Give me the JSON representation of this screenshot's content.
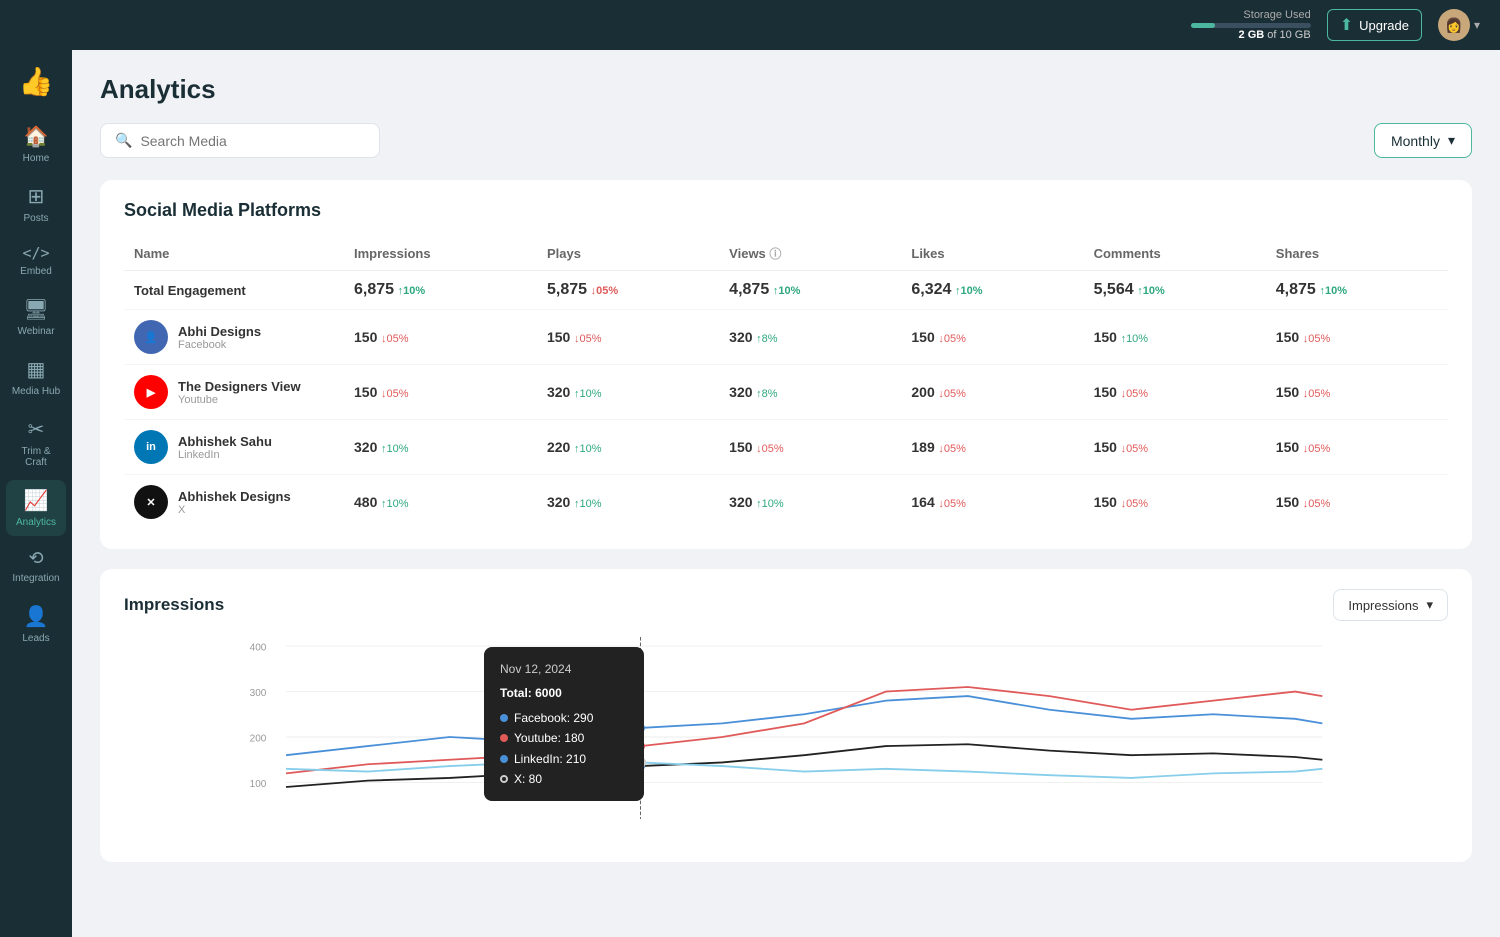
{
  "topbar": {
    "storage_label": "Storage Used",
    "storage_used": "2 GB",
    "storage_total": "10 GB",
    "storage_text": "2 GB of 10 GB",
    "upgrade_label": "Upgrade"
  },
  "sidebar": {
    "items": [
      {
        "id": "home",
        "label": "Home",
        "icon": "🏠"
      },
      {
        "id": "posts",
        "label": "Posts",
        "icon": "▦"
      },
      {
        "id": "embed",
        "label": "Embed",
        "icon": "</>"
      },
      {
        "id": "webinar",
        "label": "Webinar",
        "icon": "🖥"
      },
      {
        "id": "media-hub",
        "label": "Media Hub",
        "icon": "⊞"
      },
      {
        "id": "trim-craft",
        "label": "Trim & Craft",
        "icon": "✂"
      },
      {
        "id": "analytics",
        "label": "Analytics",
        "icon": "📈",
        "active": true
      },
      {
        "id": "integration",
        "label": "Integration",
        "icon": "⟲"
      },
      {
        "id": "leads",
        "label": "Leads",
        "icon": "👤"
      }
    ]
  },
  "page": {
    "title": "Analytics"
  },
  "search": {
    "placeholder": "Search Media"
  },
  "filter": {
    "label": "Monthly"
  },
  "social_section": {
    "title": "Social Media Platforms",
    "columns": [
      "Name",
      "Impressions",
      "Plays",
      "Views",
      "Likes",
      "Comments",
      "Shares"
    ],
    "total_row": {
      "name": "Total Engagement",
      "impressions": "6,875",
      "impressions_change": "↑10%",
      "impressions_up": true,
      "plays": "5,875",
      "plays_change": "↓05%",
      "plays_up": false,
      "views": "4,875",
      "views_change": "↑10%",
      "views_up": true,
      "likes": "6,324",
      "likes_change": "↑10%",
      "likes_up": true,
      "comments": "5,564",
      "comments_change": "↑10%",
      "comments_up": true,
      "shares": "4,875",
      "shares_change": "↑10%",
      "shares_up": true
    },
    "rows": [
      {
        "name": "Abhi Designs",
        "platform": "Facebook",
        "avatar_color": "#4267B2",
        "avatar_emoji": "👤",
        "impressions": "150",
        "impressions_change": "↓05%",
        "impressions_up": false,
        "plays": "150",
        "plays_change": "↓05%",
        "plays_up": false,
        "views": "320",
        "views_change": "↑8%",
        "views_up": true,
        "likes": "150",
        "likes_change": "↓05%",
        "likes_up": false,
        "comments": "150",
        "comments_change": "↑10%",
        "comments_up": true,
        "shares": "150",
        "shares_change": "↓05%",
        "shares_up": false
      },
      {
        "name": "The Designers View",
        "platform": "Youtube",
        "avatar_color": "#FF0000",
        "avatar_emoji": "🎥",
        "impressions": "150",
        "impressions_change": "↓05%",
        "impressions_up": false,
        "plays": "320",
        "plays_change": "↑10%",
        "plays_up": true,
        "views": "320",
        "views_change": "↑8%",
        "views_up": true,
        "likes": "200",
        "likes_change": "↓05%",
        "likes_up": false,
        "comments": "150",
        "comments_change": "↓05%",
        "comments_up": false,
        "shares": "150",
        "shares_change": "↓05%",
        "shares_up": false
      },
      {
        "name": "Abhishek Sahu",
        "platform": "LinkedIn",
        "avatar_color": "#0077B5",
        "avatar_emoji": "💼",
        "impressions": "320",
        "impressions_change": "↑10%",
        "impressions_up": true,
        "plays": "220",
        "plays_change": "↑10%",
        "plays_up": true,
        "views": "150",
        "views_change": "↓05%",
        "views_up": false,
        "likes": "189",
        "likes_change": "↓05%",
        "likes_up": false,
        "comments": "150",
        "comments_change": "↓05%",
        "comments_up": false,
        "shares": "150",
        "shares_change": "↓05%",
        "shares_up": false
      },
      {
        "name": "Abhishek Designs",
        "platform": "X",
        "avatar_color": "#000000",
        "avatar_emoji": "✕",
        "impressions": "480",
        "impressions_change": "↑10%",
        "impressions_up": true,
        "plays": "320",
        "plays_change": "↑10%",
        "plays_up": true,
        "views": "320",
        "views_change": "↑10%",
        "views_up": true,
        "likes": "164",
        "likes_change": "↓05%",
        "likes_up": false,
        "comments": "150",
        "comments_change": "↓05%",
        "comments_up": false,
        "shares": "150",
        "shares_change": "↓05%",
        "shares_up": false
      }
    ]
  },
  "chart": {
    "title": "Impressions",
    "dropdown_label": "Impressions",
    "y_labels": [
      "400",
      "300",
      "200",
      "100"
    ],
    "tooltip": {
      "date": "Nov 12, 2024",
      "total_label": "Total:",
      "total_value": "6000",
      "rows": [
        {
          "label": "Facebook:",
          "value": "290",
          "color_class": "fb"
        },
        {
          "label": "Youtube:",
          "value": "180",
          "color_class": "yt"
        },
        {
          "label": "LinkedIn:",
          "value": "210",
          "color_class": "li"
        },
        {
          "label": "X:",
          "value": "80",
          "color_class": "x"
        }
      ]
    }
  }
}
